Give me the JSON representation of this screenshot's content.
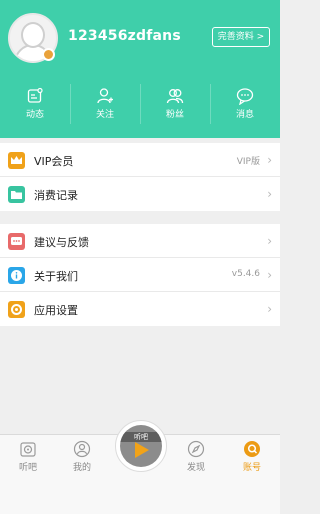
{
  "header": {
    "username": "123456zdfans",
    "edit_profile_label": "完善资料 >",
    "stats": [
      {
        "label": "动态",
        "icon": "post-icon"
      },
      {
        "label": "关注",
        "icon": "add-user-icon"
      },
      {
        "label": "粉丝",
        "icon": "fans-icon"
      },
      {
        "label": "消息",
        "icon": "message-icon"
      }
    ]
  },
  "menu": {
    "group1": [
      {
        "label": "VIP会员",
        "value": "VIP版",
        "icon": "crown-icon",
        "color": "#f0a21a"
      },
      {
        "label": "消费记录",
        "value": "",
        "icon": "folder-icon",
        "color": "#38c4a0"
      }
    ],
    "group2": [
      {
        "label": "建议与反馈",
        "value": "",
        "icon": "feedback-icon",
        "color": "#e86a6a"
      },
      {
        "label": "关于我们",
        "value": "v5.4.6",
        "icon": "info-icon",
        "color": "#2aa6e8"
      },
      {
        "label": "应用设置",
        "value": "",
        "icon": "settings-icon",
        "color": "#f0a21a"
      }
    ],
    "chevron": "›"
  },
  "tabbar": {
    "tabs": [
      {
        "label": "听吧",
        "icon": "radio-icon",
        "active": false
      },
      {
        "label": "我的",
        "icon": "person-icon",
        "active": false
      },
      {
        "label": "发现",
        "icon": "compass-icon",
        "active": false
      },
      {
        "label": "账号",
        "icon": "account-icon",
        "active": true
      }
    ],
    "center_text": "听吧"
  },
  "colors": {
    "accent": "#3fcfaa",
    "active_tab": "#ec9b14"
  }
}
